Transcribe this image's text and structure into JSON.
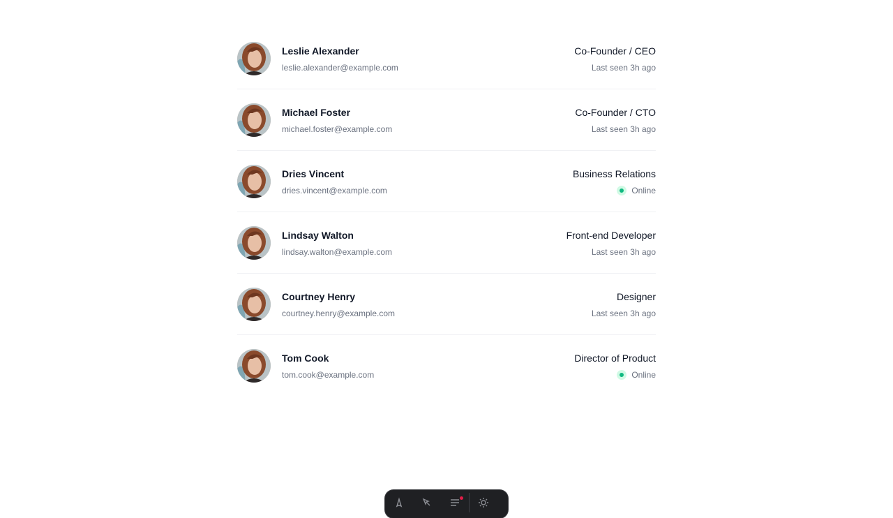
{
  "people": [
    {
      "name": "Leslie Alexander",
      "email": "leslie.alexander@example.com",
      "role": "Co-Founder / CEO",
      "status": "Last seen 3h ago",
      "online": false
    },
    {
      "name": "Michael Foster",
      "email": "michael.foster@example.com",
      "role": "Co-Founder / CTO",
      "status": "Last seen 3h ago",
      "online": false
    },
    {
      "name": "Dries Vincent",
      "email": "dries.vincent@example.com",
      "role": "Business Relations",
      "status": "Online",
      "online": true
    },
    {
      "name": "Lindsay Walton",
      "email": "lindsay.walton@example.com",
      "role": "Front-end Developer",
      "status": "Last seen 3h ago",
      "online": false
    },
    {
      "name": "Courtney Henry",
      "email": "courtney.henry@example.com",
      "role": "Designer",
      "status": "Last seen 3h ago",
      "online": false
    },
    {
      "name": "Tom Cook",
      "email": "tom.cook@example.com",
      "role": "Director of Product",
      "status": "Online",
      "online": true
    }
  ],
  "colors": {
    "online_dot": "#10b981",
    "online_ring": "#d1fae5",
    "toolbar_bg": "#1f2023"
  },
  "toolbar": {
    "icons": [
      "astro-logo-icon",
      "inspect-icon",
      "audit-icon",
      "settings-icon"
    ]
  }
}
